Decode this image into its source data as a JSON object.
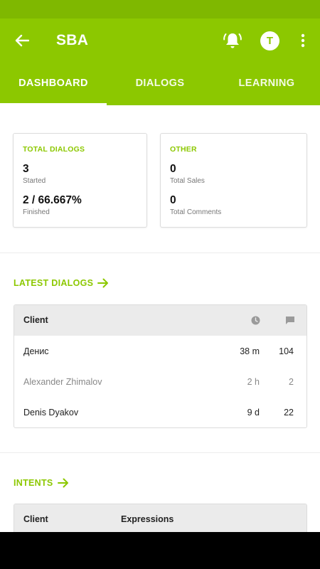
{
  "app_bar": {
    "title": "SBA",
    "avatar_letter": "T",
    "icons": [
      "back-arrow-icon",
      "bell-ringing-icon",
      "more-vertical-icon"
    ]
  },
  "tabs": [
    {
      "label": "DASHBOARD",
      "active": true
    },
    {
      "label": "DIALOGS",
      "active": false
    },
    {
      "label": "LEARNING",
      "active": false
    }
  ],
  "total_dialogs": {
    "label": "TOTAL DIALOGS",
    "started_value": "3",
    "started_caption": "Started",
    "finished_value": "2 / 66.667%",
    "finished_caption": "Finished"
  },
  "other": {
    "label": "OTHER",
    "sales_value": "0",
    "sales_caption": "Total Sales",
    "comments_value": "0",
    "comments_caption": "Total Comments"
  },
  "latest_dialogs": {
    "link_label": "LATEST DIALOGS",
    "header": {
      "client": "Client",
      "time_icon": "clock-icon",
      "messages_icon": "message-icon"
    },
    "rows": [
      {
        "client": "Денис",
        "time": "38 m",
        "count": "104",
        "muted": false
      },
      {
        "client": "Alexander Zhimalov",
        "time": "2 h",
        "count": "2",
        "muted": true
      },
      {
        "client": "Denis Dyakov",
        "time": "9 d",
        "count": "22",
        "muted": false
      }
    ]
  },
  "intents": {
    "link_label": "INTENTS",
    "header": {
      "client": "Client",
      "expressions": "Expressions"
    }
  },
  "colors": {
    "accent": "#8cc800",
    "status_bar": "#7fb800",
    "header_bg": "#ebebeb"
  }
}
